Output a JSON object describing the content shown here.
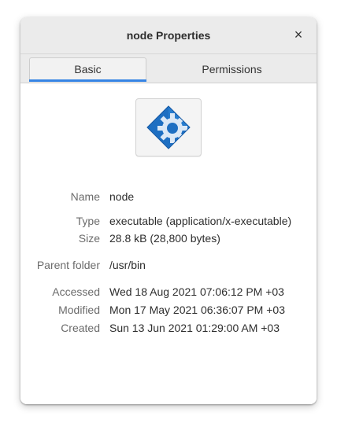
{
  "window": {
    "title": "node Properties",
    "close_symbol": "×"
  },
  "tabs": [
    {
      "label": "Basic",
      "active": true
    },
    {
      "label": "Permissions",
      "active": false
    }
  ],
  "file_icon": {
    "icon": "executable-gear-diamond-icon"
  },
  "properties": {
    "name": {
      "label": "Name",
      "value": "node"
    },
    "type": {
      "label": "Type",
      "value": "executable (application/x-executable)"
    },
    "size": {
      "label": "Size",
      "value": "28.8 kB (28,800 bytes)"
    },
    "parent_folder": {
      "label": "Parent folder",
      "value": "/usr/bin"
    },
    "accessed": {
      "label": "Accessed",
      "value": "Wed 18 Aug 2021 07:06:12 PM +03"
    },
    "modified": {
      "label": "Modified",
      "value": "Mon 17 May 2021 06:36:07 PM +03"
    },
    "created": {
      "label": "Created",
      "value": "Sun 13 Jun 2021 01:29:00 AM +03"
    }
  },
  "colors": {
    "accent": "#3584e4",
    "icon_blue": "#1e6fc2",
    "icon_blue_dark": "#155aa6"
  }
}
